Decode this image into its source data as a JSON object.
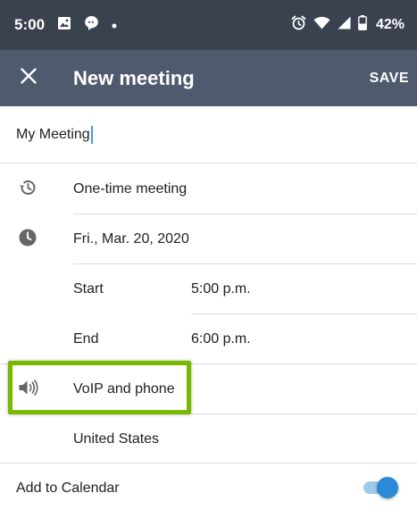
{
  "status_bar": {
    "time": "5:00",
    "battery": "42%",
    "icons": [
      "image-icon",
      "chat-bubble-icon",
      "dot-icon",
      "alarm-icon",
      "wifi-icon",
      "signal-icon",
      "battery-icon"
    ]
  },
  "app_bar": {
    "title": "New meeting",
    "save_label": "SAVE",
    "close_icon": "close-icon"
  },
  "meeting": {
    "title_value": "My Meeting",
    "recurrence": "One-time meeting",
    "date": "Fri., Mar. 20, 2020",
    "start_label": "Start",
    "start_time": "5:00 p.m.",
    "end_label": "End",
    "end_time": "6:00 p.m.",
    "audio": "VoIP and phone",
    "country": "United States",
    "add_to_calendar_label": "Add to Calendar",
    "add_to_calendar_on": true
  },
  "colors": {
    "status_bar": "#3a4250",
    "app_bar": "#4f5a6e",
    "highlight": "#7ab800",
    "toggle_thumb": "#2b8ad8",
    "toggle_track": "#9dcbea",
    "caret": "#3aa0e0"
  }
}
